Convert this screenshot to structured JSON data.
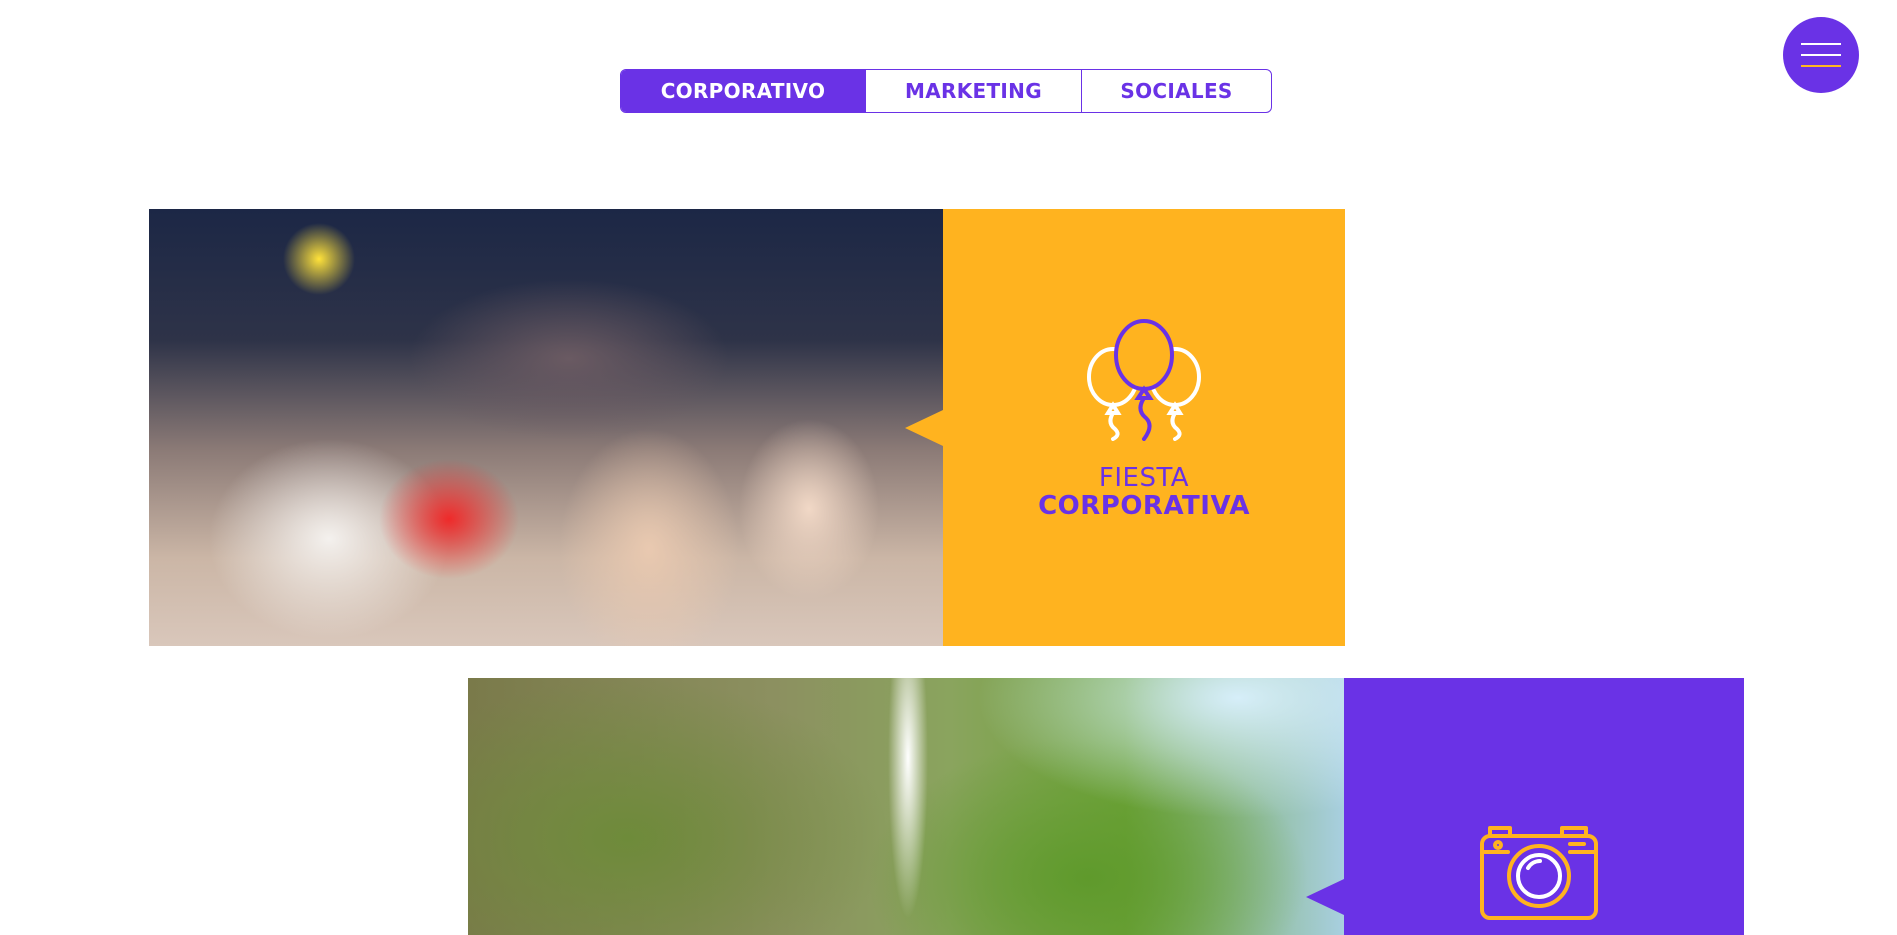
{
  "tabs": [
    {
      "label": "CORPORATIVO",
      "active": true
    },
    {
      "label": "MARKETING",
      "active": false
    },
    {
      "label": "SOCIALES",
      "active": false
    }
  ],
  "menu": {
    "icon": "hamburger-icon"
  },
  "cards": [
    {
      "image": "corporate-party-crowd-photo",
      "icon": "balloons-icon",
      "title_line1": "FIESTA",
      "title_line2": "CORPORATIVA",
      "background": "#ffb31f"
    },
    {
      "image": "waterfall-landscape-photo",
      "icon": "camera-icon",
      "background": "#6a32e6"
    }
  ],
  "colors": {
    "accent": "#6a32e6",
    "secondary": "#ffb31f"
  }
}
